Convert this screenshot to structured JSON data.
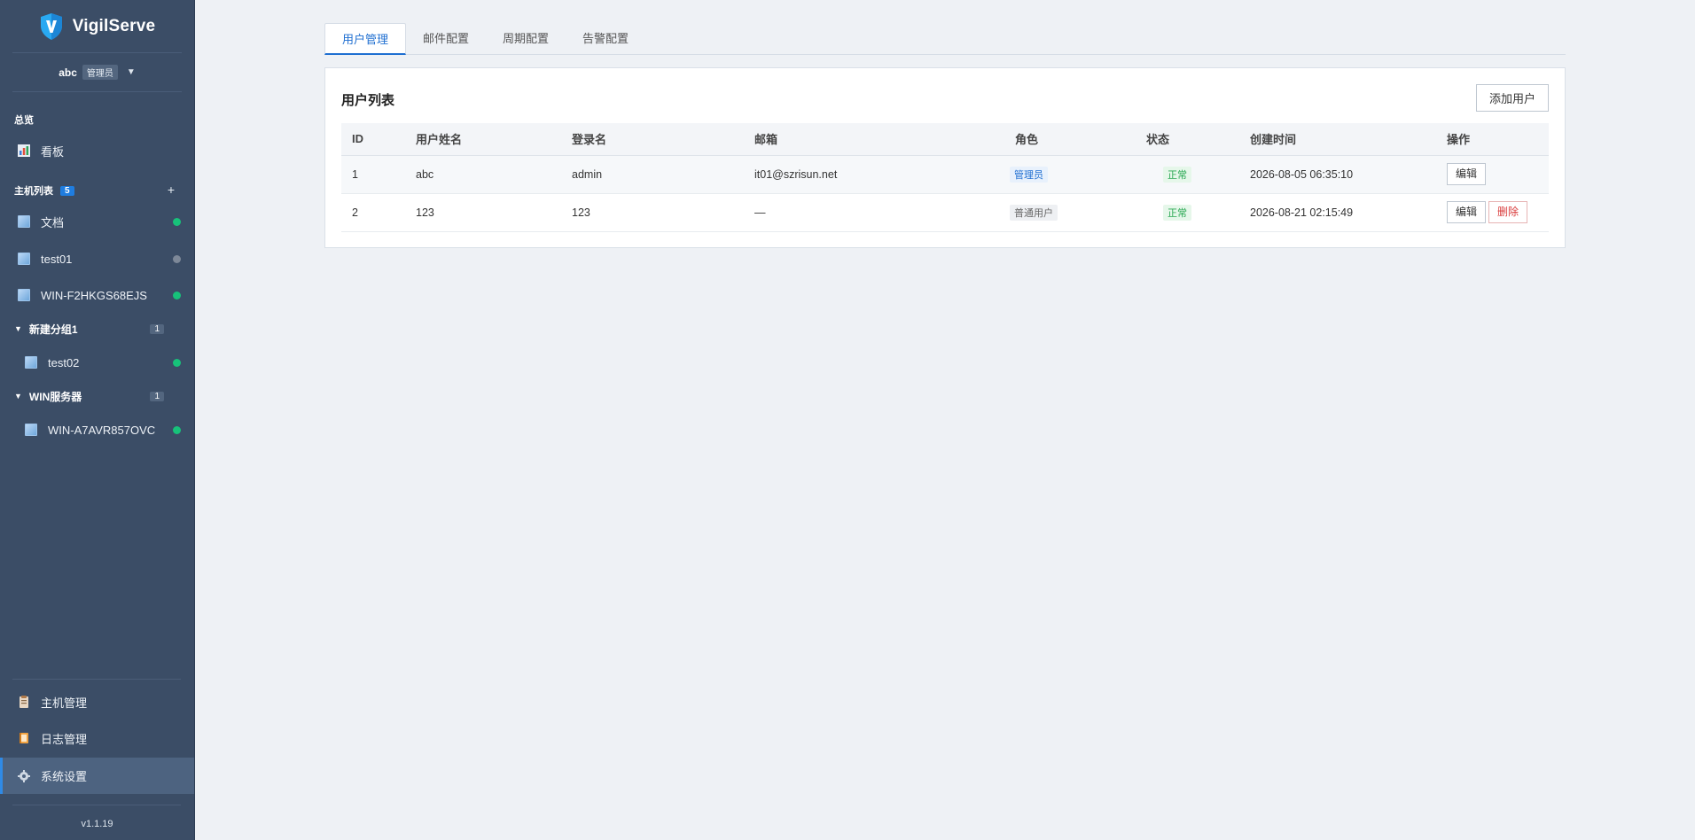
{
  "app": {
    "name": "VigilServe",
    "version": "v1.1.19"
  },
  "user": {
    "name": "abc",
    "role": "管理员"
  },
  "sidebar": {
    "overview_label": "总览",
    "dashboard_label": "看板",
    "hosts_label": "主机列表",
    "hosts_count": "5",
    "hosts": [
      {
        "name": "文档",
        "status": "online"
      },
      {
        "name": "test01",
        "status": "offline"
      },
      {
        "name": "WIN-F2HKGS68EJS",
        "status": "online"
      }
    ],
    "groups": [
      {
        "name": "新建分组1",
        "count": "1",
        "hosts": [
          {
            "name": "test02",
            "status": "online"
          }
        ]
      },
      {
        "name": "WIN服务器",
        "count": "1",
        "hosts": [
          {
            "name": "WIN-A7AVR857OVC",
            "status": "online"
          }
        ]
      }
    ],
    "bottom_nav": [
      {
        "label": "主机管理"
      },
      {
        "label": "日志管理"
      },
      {
        "label": "系统设置"
      }
    ]
  },
  "tabs": [
    {
      "label": "用户管理"
    },
    {
      "label": "邮件配置"
    },
    {
      "label": "周期配置"
    },
    {
      "label": "告警配置"
    }
  ],
  "panel": {
    "title": "用户列表",
    "add_button": "添加用户",
    "columns": [
      "ID",
      "用户姓名",
      "登录名",
      "邮箱",
      "角色",
      "状态",
      "创建时间",
      "操作"
    ],
    "rows": [
      {
        "id": "1",
        "name": "abc",
        "login": "admin",
        "email": "it01@szrisun.net",
        "role": "管理员",
        "status": "正常",
        "created": "2026-08-05 06:35:10",
        "edit": "编辑"
      },
      {
        "id": "2",
        "name": "123",
        "login": "123",
        "email": "—",
        "role": "普通用户",
        "status": "正常",
        "created": "2026-08-21 02:15:49",
        "edit": "编辑",
        "delete": "删除"
      }
    ]
  },
  "colors": {
    "sidebar_bg": "#3b4d66",
    "accent": "#1f6fd1",
    "online": "#17c27a",
    "offline": "#7d8898",
    "danger": "#d93b3b"
  }
}
